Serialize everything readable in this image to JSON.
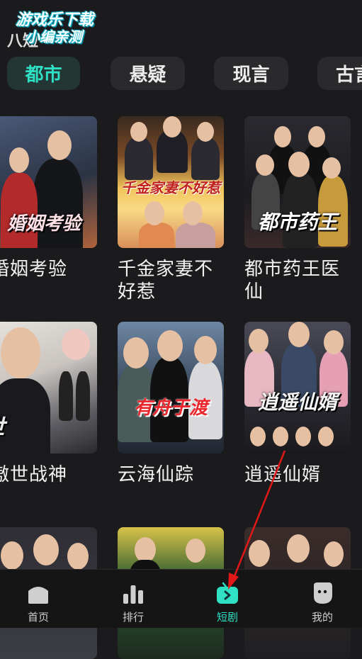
{
  "watermark": {
    "line1": "游戏乐下载",
    "line2": "小编亲测",
    "prefix": "八短"
  },
  "tabs": [
    {
      "label": "都市",
      "active": true
    },
    {
      "label": "悬疑",
      "active": false
    },
    {
      "label": "现言",
      "active": false
    },
    {
      "label": "古言",
      "active": false
    }
  ],
  "cards": [
    {
      "title": "婚姻考验",
      "poster_text": "婚姻考验",
      "colors": [
        "#3a4660",
        "#b0643c"
      ]
    },
    {
      "title": "千金家妻不好惹",
      "poster_text": "千金家妻不好惹",
      "colors": [
        "#e9a33a",
        "#f7d37a"
      ]
    },
    {
      "title": "都市药王医仙",
      "poster_text": "都市药王",
      "colors": [
        "#1f1d22",
        "#4a3a40"
      ]
    },
    {
      "title": "傲世战神",
      "poster_text": "傲世",
      "colors": [
        "#d8d6d4",
        "#4a4a52"
      ]
    },
    {
      "title": "云海仙踪",
      "poster_text": "有舟于渡",
      "colors": [
        "#6a86a6",
        "#2b3440"
      ]
    },
    {
      "title": "逍遥仙婿",
      "poster_text": "逍遥仙婿",
      "colors": [
        "#4a4550",
        "#1e1e22"
      ]
    },
    {
      "title": "",
      "poster_text": "",
      "colors": [
        "#2a2a2e",
        "#3b3b40"
      ]
    },
    {
      "title": "",
      "poster_text": "",
      "colors": [
        "#7a6a2a",
        "#1e3a22"
      ]
    },
    {
      "title": "",
      "poster_text": "",
      "colors": [
        "#3a2a28",
        "#1f1f22"
      ]
    }
  ],
  "nav": [
    {
      "label": "首页",
      "icon": "home-icon",
      "active": false
    },
    {
      "label": "排行",
      "icon": "ranking-icon",
      "active": false
    },
    {
      "label": "短剧",
      "icon": "tv-play-icon",
      "active": true
    },
    {
      "label": "我的",
      "icon": "profile-icon",
      "active": false
    }
  ],
  "accent_color": "#2fe0c4",
  "annotation": {
    "type": "red-arrow",
    "color": "#e01818"
  }
}
